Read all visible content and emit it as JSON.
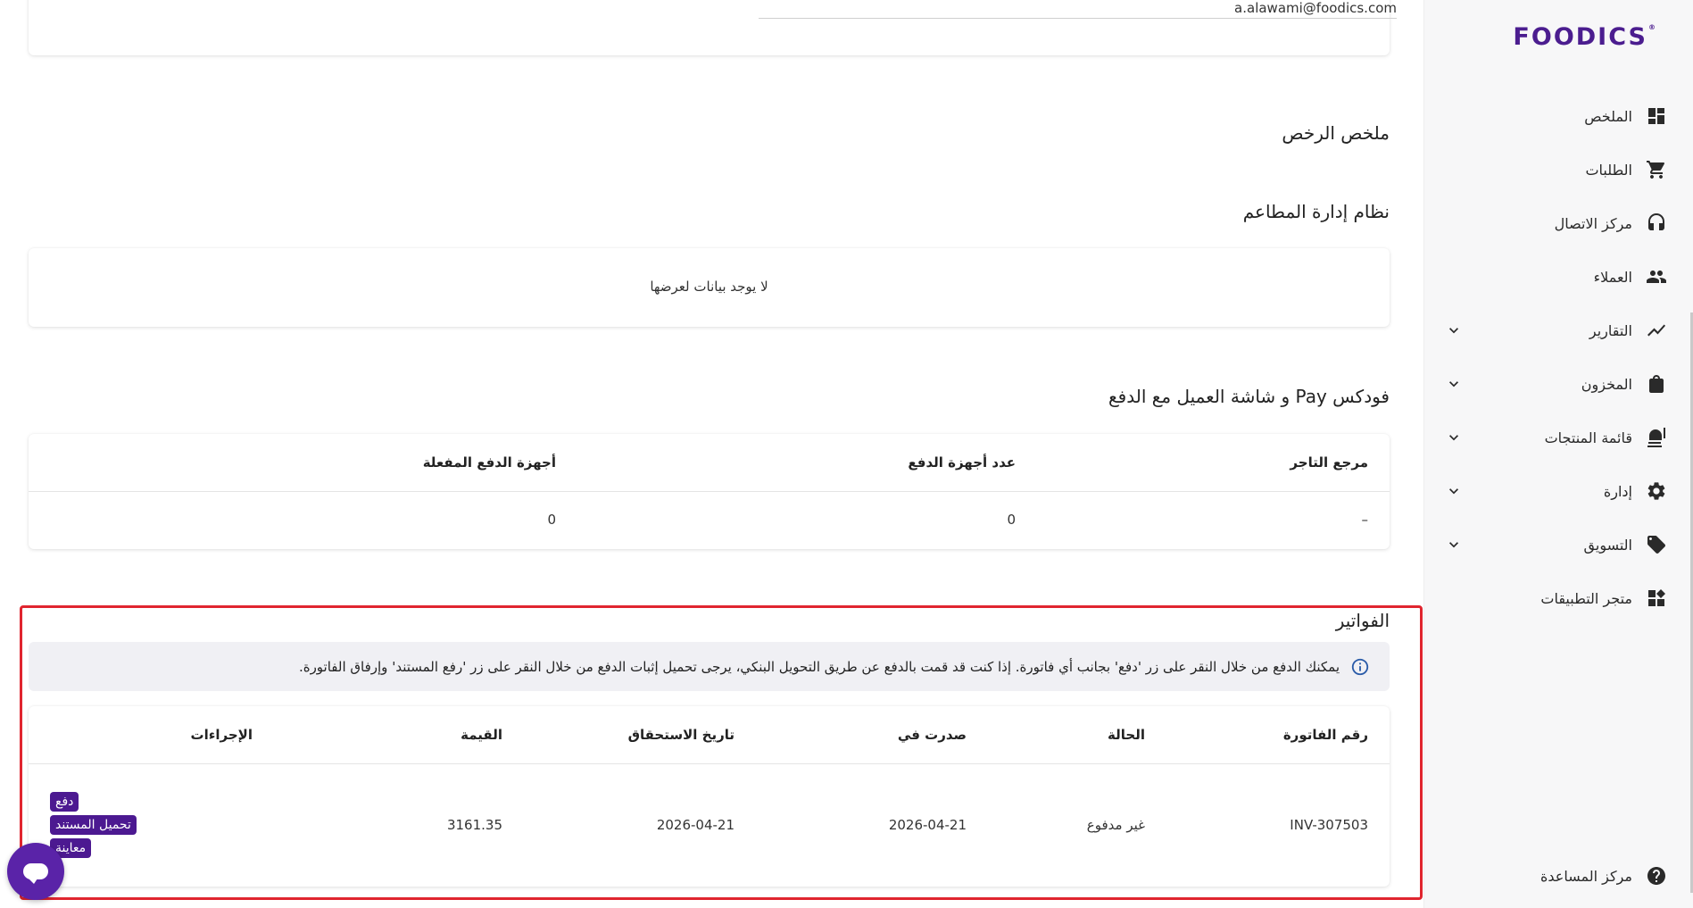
{
  "brand": {
    "logo_text": "FOODICS",
    "color": "#4b1d8f"
  },
  "sidebar": {
    "items": [
      {
        "label": "الملخص",
        "icon": "dashboard-icon",
        "has_chevron": false
      },
      {
        "label": "الطلبات",
        "icon": "cart-icon",
        "has_chevron": false
      },
      {
        "label": "مركز الاتصال",
        "icon": "headset-icon",
        "has_chevron": false
      },
      {
        "label": "العملاء",
        "icon": "people-icon",
        "has_chevron": false
      },
      {
        "label": "التقارير",
        "icon": "trending-icon",
        "has_chevron": true
      },
      {
        "label": "المخزون",
        "icon": "bag-icon",
        "has_chevron": true
      },
      {
        "label": "قائمة المنتجات",
        "icon": "menu-food-icon",
        "has_chevron": true
      },
      {
        "label": "إدارة",
        "icon": "gear-icon",
        "has_chevron": true
      },
      {
        "label": "التسويق",
        "icon": "tag-icon",
        "has_chevron": true
      },
      {
        "label": "متجر التطبيقات",
        "icon": "apps-icon",
        "has_chevron": false
      }
    ],
    "help_label": "مركز المساعدة"
  },
  "account": {
    "email": "a.alawami@foodics.com"
  },
  "licenses": {
    "title": "ملخص الرخص",
    "pos_title": "نظام إدارة المطاعم",
    "empty_text": "لا يوجد بيانات لعرضها"
  },
  "payments": {
    "title": "فودكس Pay و شاشة العميل مع الدفع",
    "columns": [
      "مرجع التاجر",
      "عدد أجهزة الدفع",
      "أجهزة الدفع المفعلة"
    ],
    "row": [
      "–",
      "0",
      "0"
    ]
  },
  "invoices": {
    "title": "الفواتير",
    "info": "يمكنك الدفع من خلال النقر على زر 'دفع' بجانب أي فاتورة. إذا كنت قد قمت بالدفع عن طريق التحويل البنكي، يرجى تحميل إثبات الدفع من خلال النقر على زر 'رفع المستند' وإرفاق الفاتورة.",
    "columns": [
      "رقم الفاتورة",
      "الحالة",
      "صدرت في",
      "تاريخ الاستحقاق",
      "القيمة",
      "الإجراءات"
    ],
    "rows": [
      {
        "number": "INV-307503",
        "status": "غير مدفوع",
        "issued": "2026-04-21",
        "due": "2026-04-21",
        "amount": "3161.35",
        "actions": [
          "دفع",
          "تحميل المستند",
          "معاينة"
        ]
      }
    ],
    "highlight_color": "#e0252f",
    "button_color": "#4c1991"
  }
}
